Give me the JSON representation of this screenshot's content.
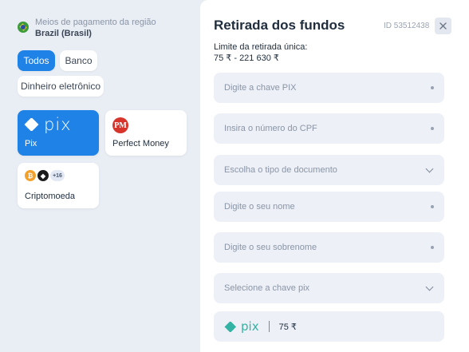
{
  "region": {
    "caption": "Meios de pagamento da região",
    "country": "Brazil (Brasil)",
    "flag_icon": "brazil-flag-icon"
  },
  "filters": [
    {
      "label": "Todos",
      "active": true
    },
    {
      "label": "Banco",
      "active": false
    },
    {
      "label": "Dinheiro eletrônico",
      "active": false
    }
  ],
  "methods": {
    "pix": {
      "logo_text": "pix",
      "label": "Pix",
      "selected": true
    },
    "perfect_money": {
      "icon_text": "PM",
      "label": "Perfect Money"
    },
    "crypto": {
      "more_badge": "+16",
      "label": "Criptomoeda"
    }
  },
  "withdrawal": {
    "title": "Retirada dos fundos",
    "id_text": "ID 53512438",
    "limit_label": "Limite da retirada única:",
    "limit_value": "75 ₹ - 221 630 ₹",
    "fields": {
      "pix_key_placeholder": "Digite a chave PIX",
      "cpf_placeholder": "Insira o número do CPF",
      "doc_type_placeholder": "Escolha o tipo de documento",
      "first_name_placeholder": "Digite o seu nome",
      "last_name_placeholder": "Digite o seu sobrenome",
      "pix_key_type_placeholder": "Selecione a chave pix"
    },
    "amount": {
      "logo_text": "pix",
      "value": "75 ₹"
    }
  },
  "colors": {
    "accent": "#1f82e6",
    "pix_teal": "#32b3a3",
    "pm_red": "#d7352c"
  }
}
